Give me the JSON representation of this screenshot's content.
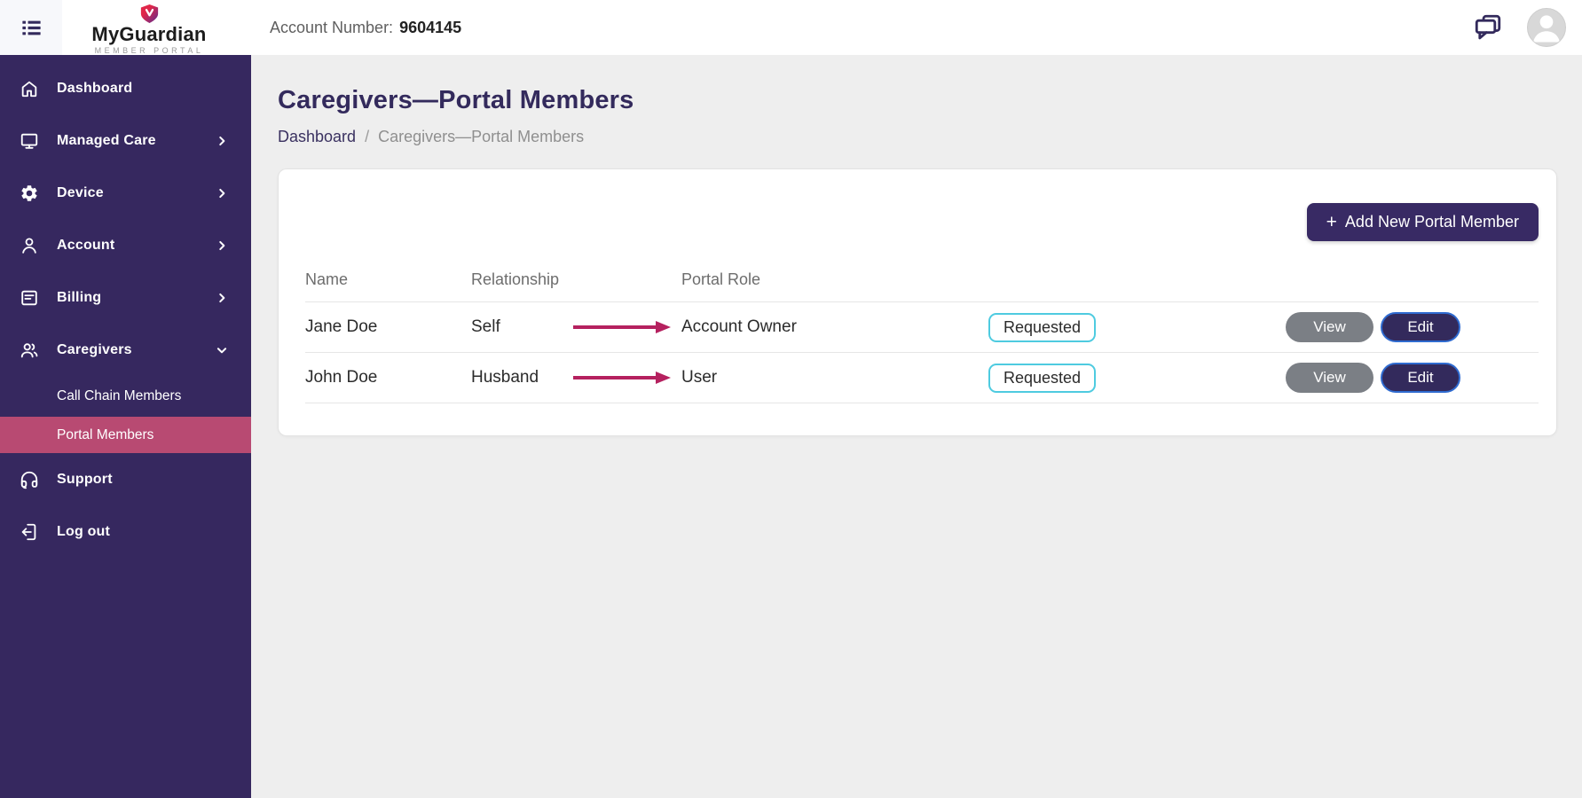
{
  "colors": {
    "sidebar_bg": "#36285F",
    "active_item_bg": "#B84A72",
    "brand_dark": "#332A5C",
    "arrow": "#B5215F",
    "badge_border": "#4ECBE0",
    "view_btn_bg": "#7B7F85",
    "edit_btn_bg": "#332A5C",
    "edit_btn_border": "#2F6BD0",
    "page_bg": "#EEEEEE",
    "shield_red": "#E02649",
    "shield_purple": "#5C2D91"
  },
  "header": {
    "logo": {
      "brand": "MyGuardian",
      "tagline": "MEMBER PORTAL"
    },
    "account_label": "Account Number:",
    "account_number": "9604145"
  },
  "sidebar": {
    "items": [
      {
        "label": "Dashboard",
        "icon": "home-icon"
      },
      {
        "label": "Managed Care",
        "icon": "monitor-icon",
        "chevron": "right"
      },
      {
        "label": "Device",
        "icon": "gear-icon",
        "chevron": "right"
      },
      {
        "label": "Account",
        "icon": "user-icon",
        "chevron": "right"
      },
      {
        "label": "Billing",
        "icon": "billing-icon",
        "chevron": "right"
      },
      {
        "label": "Caregivers",
        "icon": "caregivers-icon",
        "chevron": "down",
        "expanded": true
      },
      {
        "label": "Support",
        "icon": "headset-icon"
      },
      {
        "label": "Log out",
        "icon": "logout-icon"
      }
    ],
    "sub_items": [
      {
        "label": "Call Chain Members",
        "active": false
      },
      {
        "label": "Portal Members",
        "active": true
      }
    ]
  },
  "page": {
    "title": "Caregivers—Portal Members",
    "breadcrumb": {
      "root": "Dashboard",
      "separator": "/",
      "current": "Caregivers—Portal Members"
    }
  },
  "card": {
    "add_button": {
      "plus": "+",
      "label": "Add New Portal Member"
    },
    "table": {
      "columns": [
        "Name",
        "Relationship",
        "Portal Role"
      ],
      "rows": [
        {
          "name": "Jane Doe",
          "relationship": "Self",
          "portal_role": "Account Owner",
          "status": "Requested",
          "view_label": "View",
          "edit_label": "Edit"
        },
        {
          "name": "John Doe",
          "relationship": "Husband",
          "portal_role": "User",
          "status": "Requested",
          "view_label": "View",
          "edit_label": "Edit"
        }
      ]
    }
  }
}
